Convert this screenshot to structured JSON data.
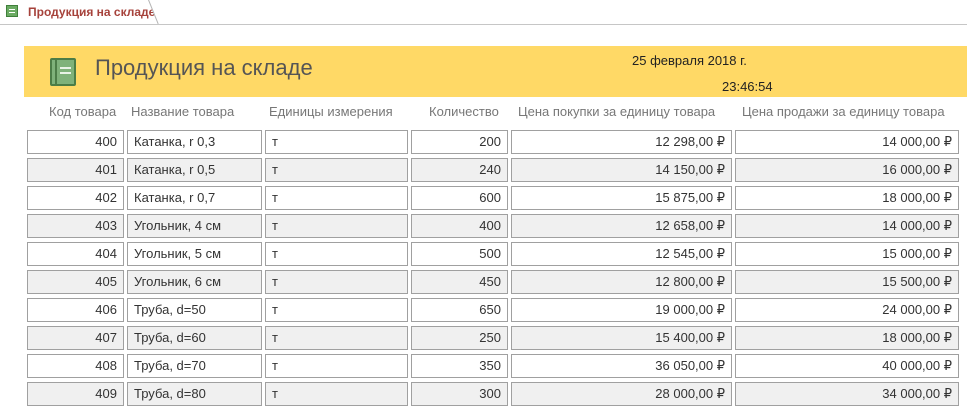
{
  "tab": {
    "label": "Продукция на складе"
  },
  "header": {
    "title": "Продукция на складе",
    "date": "25 февраля 2018 г.",
    "time": "23:46:54"
  },
  "columns": [
    "Код товара",
    "Название товара",
    "Единицы измерения",
    "Количество",
    "Цена покупки за единицу товара",
    "Цена продажи за единицу товара"
  ],
  "rows": [
    {
      "code": "400",
      "name": "Катанка, r 0,3",
      "unit": "т",
      "qty": "200",
      "buy": "12 298,00 ₽",
      "sell": "14 000,00 ₽"
    },
    {
      "code": "401",
      "name": "Катанка, r 0,5",
      "unit": "т",
      "qty": "240",
      "buy": "14 150,00 ₽",
      "sell": "16 000,00 ₽"
    },
    {
      "code": "402",
      "name": "Катанка, r 0,7",
      "unit": "т",
      "qty": "600",
      "buy": "15 875,00 ₽",
      "sell": "18 000,00 ₽"
    },
    {
      "code": "403",
      "name": "Угольник, 4 см",
      "unit": "т",
      "qty": "400",
      "buy": "12 658,00 ₽",
      "sell": "14 000,00 ₽"
    },
    {
      "code": "404",
      "name": "Угольник, 5 см",
      "unit": "т",
      "qty": "500",
      "buy": "12 545,00 ₽",
      "sell": "15 000,00 ₽"
    },
    {
      "code": "405",
      "name": "Угольник, 6 см",
      "unit": "т",
      "qty": "450",
      "buy": "12 800,00 ₽",
      "sell": "15 500,00 ₽"
    },
    {
      "code": "406",
      "name": "Труба, d=50",
      "unit": "т",
      "qty": "650",
      "buy": "19 000,00 ₽",
      "sell": "24 000,00 ₽"
    },
    {
      "code": "407",
      "name": "Труба, d=60",
      "unit": "т",
      "qty": "250",
      "buy": "15 400,00 ₽",
      "sell": "18 000,00 ₽"
    },
    {
      "code": "408",
      "name": "Труба, d=70",
      "unit": "т",
      "qty": "350",
      "buy": "36 050,00 ₽",
      "sell": "40 000,00 ₽"
    },
    {
      "code": "409",
      "name": "Труба, d=80",
      "unit": "т",
      "qty": "300",
      "buy": "28 000,00 ₽",
      "sell": "34 000,00 ₽"
    }
  ]
}
